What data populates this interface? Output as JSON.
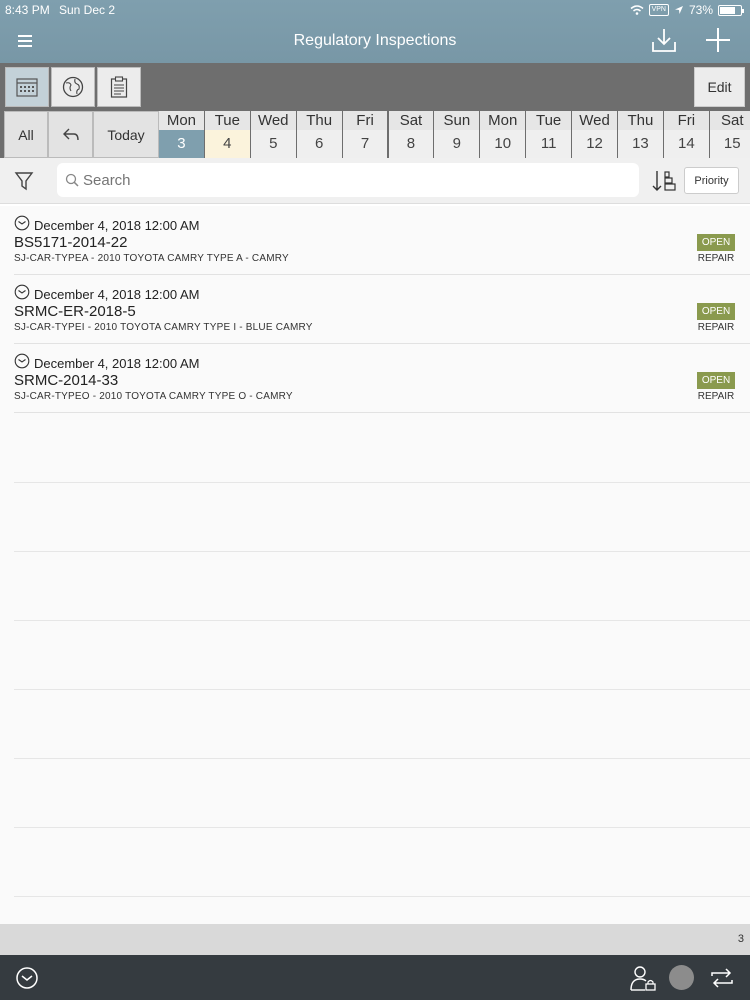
{
  "status_bar": {
    "time": "8:43 PM",
    "date": "Sun Dec 2",
    "vpn": "VPN",
    "battery": "73%",
    "battery_level": 0.73
  },
  "header": {
    "title": "Regulatory Inspections",
    "icons": [
      "hamburger-icon",
      "download-icon",
      "plus-icon"
    ]
  },
  "toolbar": {
    "view_icons": [
      "calendar-icon",
      "globe-icon",
      "clipboard-icon"
    ],
    "edit_label": "Edit"
  },
  "datebar": {
    "all_label": "All",
    "today_label": "Today",
    "days": [
      {
        "name": "Mon",
        "date": "3"
      },
      {
        "name": "Tue",
        "date": "4"
      },
      {
        "name": "Wed",
        "date": "5"
      },
      {
        "name": "Thu",
        "date": "6"
      },
      {
        "name": "Fri",
        "date": "7"
      },
      {
        "name": "Sat",
        "date": "8"
      },
      {
        "name": "Sun",
        "date": "9"
      },
      {
        "name": "Mon",
        "date": "10"
      },
      {
        "name": "Tue",
        "date": "11"
      },
      {
        "name": "Wed",
        "date": "12"
      },
      {
        "name": "Thu",
        "date": "13"
      },
      {
        "name": "Fri",
        "date": "14"
      },
      {
        "name": "Sat",
        "date": "15"
      }
    ],
    "selected_day": "3",
    "today_day": "4"
  },
  "search": {
    "placeholder": "Search",
    "sort_label": "Priority"
  },
  "inspections": [
    {
      "datetime": "December 4, 2018 12:00 AM",
      "number": "BS5171-2014-22",
      "description": "SJ-CAR-TYPEA - 2010 TOYOTA CAMRY TYPE A - CAMRY",
      "status": "OPEN",
      "type": "REPAIR"
    },
    {
      "datetime": "December 4, 2018 12:00 AM",
      "number": "SRMC-ER-2018-5",
      "description": "SJ-CAR-TYPEI - 2010 TOYOTA CAMRY TYPE I - BLUE CAMRY",
      "status": "OPEN",
      "type": "REPAIR"
    },
    {
      "datetime": "December 4, 2018 12:00 AM",
      "number": "SRMC-2014-33",
      "description": "SJ-CAR-TYPEO - 2010 TOYOTA CAMRY TYPE O - CAMRY",
      "status": "OPEN",
      "type": "REPAIR"
    }
  ],
  "footer": {
    "count": "3"
  },
  "colors": {
    "header": "#7f9fae",
    "toolbar": "#6e6e6e",
    "status_open": "#8a9a4e",
    "bottom_bar": "#353b40",
    "today_highlight": "#fbf3dc"
  }
}
